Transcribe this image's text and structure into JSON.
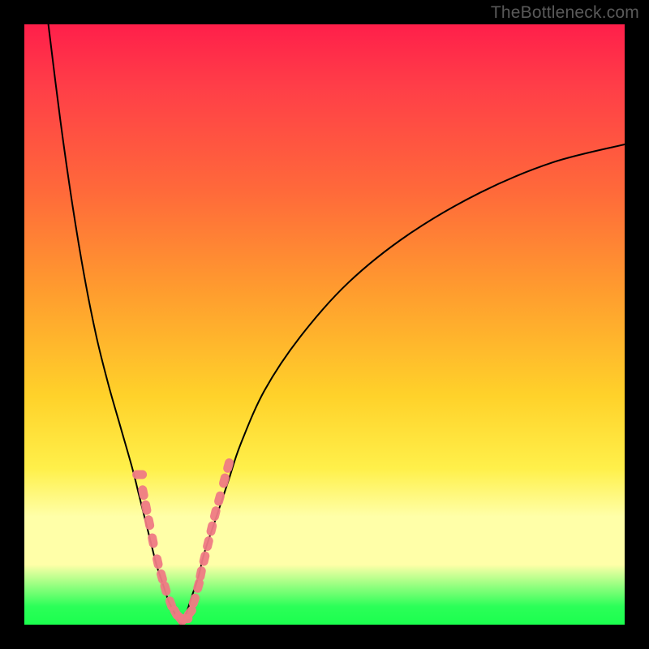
{
  "watermark": {
    "text": "TheBottleneck.com"
  },
  "colors": {
    "frame": "#000000",
    "curve": "#000000",
    "marker_fill": "#ef7a84",
    "gradient_top": "#ff1f4a",
    "gradient_mid": "#ffd22a",
    "gradient_band": "#ffffa8",
    "gradient_bottom": "#1bff4e"
  },
  "chart_data": {
    "type": "line",
    "title": "",
    "xlabel": "",
    "ylabel": "",
    "xlim": [
      0,
      100
    ],
    "ylim": [
      0,
      100
    ],
    "note": "Two smooth curves descending to a common minimum near x≈25–27 at y≈0, forming a narrow V. Left branch rises steeply to y≈100 at x≈4; right branch rises slowly to y≈80 at x≈100. Pink markers cluster on both branches in the y≈5–30 band.",
    "series": [
      {
        "name": "left-branch",
        "x": [
          4,
          6,
          8,
          10,
          12,
          14,
          16,
          18,
          19,
          20,
          21,
          22,
          23,
          24,
          25,
          26
        ],
        "y": [
          100,
          84,
          70,
          58,
          48,
          40,
          33,
          26,
          22,
          18,
          14,
          10,
          7,
          4,
          2,
          0
        ]
      },
      {
        "name": "right-branch",
        "x": [
          26,
          27,
          28,
          29,
          30,
          32,
          34,
          36,
          40,
          46,
          54,
          64,
          76,
          88,
          100
        ],
        "y": [
          0,
          2,
          5,
          8,
          12,
          18,
          24,
          30,
          39,
          48,
          57,
          65,
          72,
          77,
          80
        ]
      }
    ],
    "markers": {
      "name": "highlighted-points",
      "shape": "rounded",
      "points": [
        {
          "x": 19.2,
          "y": 25.0
        },
        {
          "x": 19.8,
          "y": 22.0
        },
        {
          "x": 20.3,
          "y": 19.5
        },
        {
          "x": 20.8,
          "y": 17.0
        },
        {
          "x": 21.4,
          "y": 14.0
        },
        {
          "x": 22.2,
          "y": 10.5
        },
        {
          "x": 22.9,
          "y": 8.0
        },
        {
          "x": 23.5,
          "y": 6.0
        },
        {
          "x": 24.4,
          "y": 3.5
        },
        {
          "x": 25.2,
          "y": 2.0
        },
        {
          "x": 26.0,
          "y": 1.0
        },
        {
          "x": 26.8,
          "y": 1.0
        },
        {
          "x": 27.6,
          "y": 2.0
        },
        {
          "x": 28.3,
          "y": 4.0
        },
        {
          "x": 29.0,
          "y": 6.5
        },
        {
          "x": 29.4,
          "y": 8.5
        },
        {
          "x": 30.0,
          "y": 11.0
        },
        {
          "x": 30.6,
          "y": 13.5
        },
        {
          "x": 31.2,
          "y": 16.0
        },
        {
          "x": 31.8,
          "y": 18.5
        },
        {
          "x": 32.5,
          "y": 21.0
        },
        {
          "x": 33.3,
          "y": 24.0
        },
        {
          "x": 34.0,
          "y": 26.5
        }
      ]
    }
  }
}
